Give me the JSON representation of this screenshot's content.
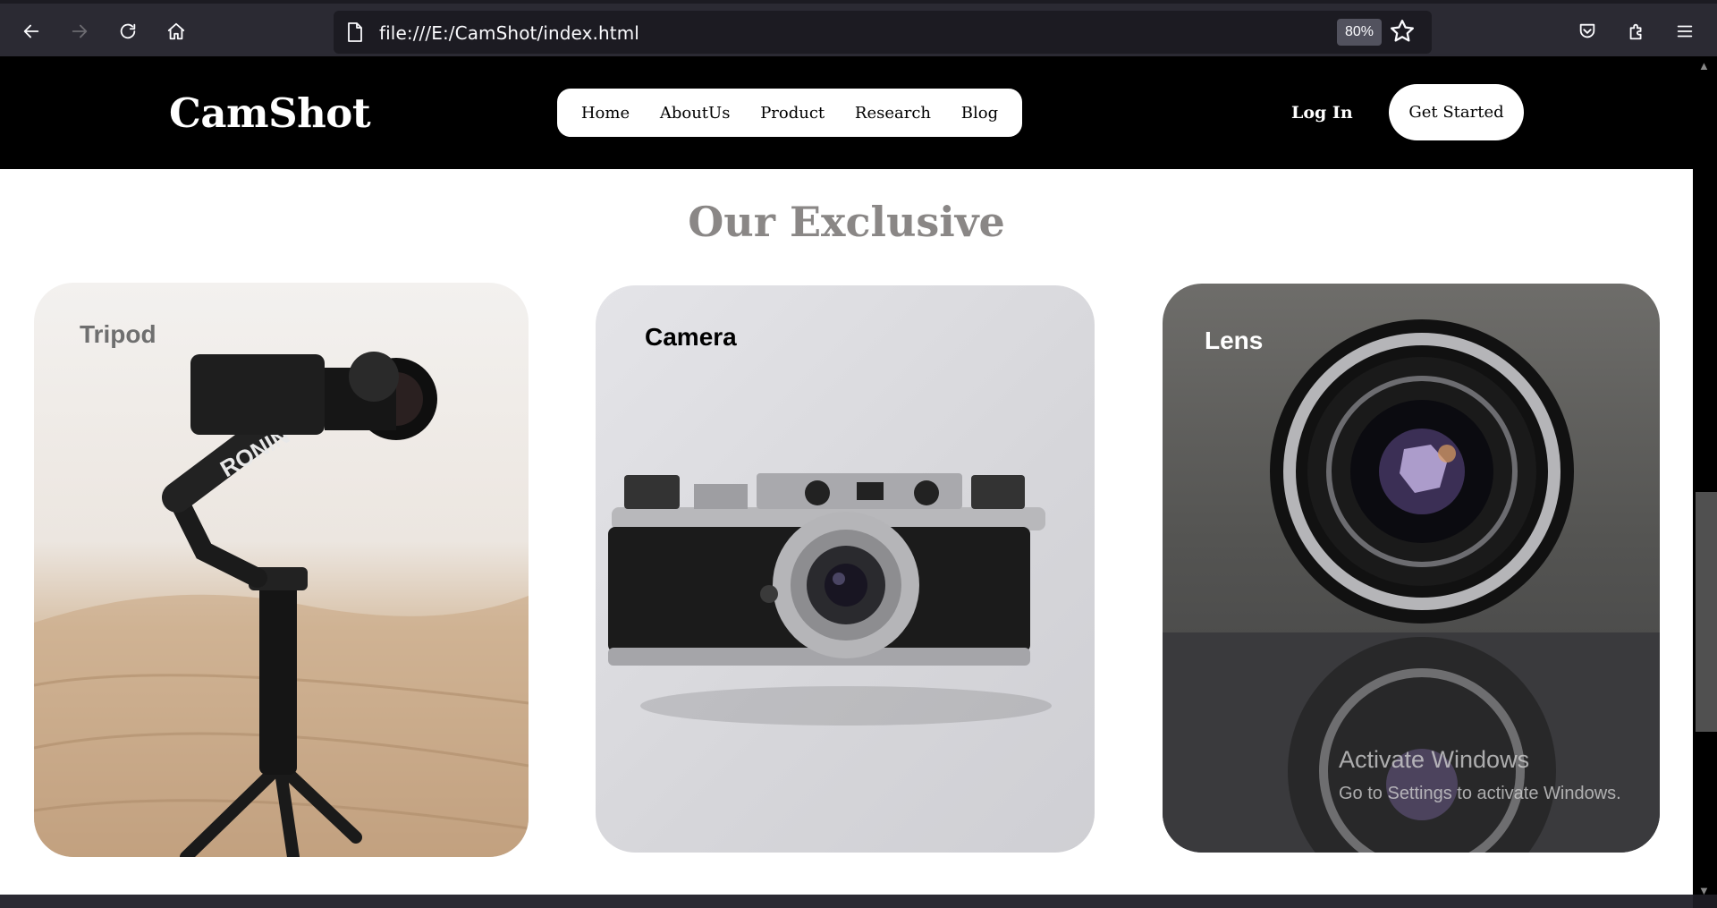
{
  "browser": {
    "url": "file:///E:/CamShot/index.html",
    "zoom": "80%",
    "icons": [
      "back-icon",
      "forward-icon",
      "reload-icon",
      "home-icon",
      "page-icon",
      "bookmark-star-icon",
      "pocket-icon",
      "extensions-icon",
      "menu-icon"
    ]
  },
  "site": {
    "logo": "CamShot",
    "nav": [
      "Home",
      "AboutUs",
      "Product",
      "Research",
      "Blog"
    ],
    "login": "Log In",
    "cta": "Get Started"
  },
  "section": {
    "title": "Our Exclusive",
    "cards": [
      {
        "label": "Tripod",
        "label_color": "#6f6f6f"
      },
      {
        "label": "Camera",
        "label_color": "#000000"
      },
      {
        "label": "Lens",
        "label_color": "#ffffff"
      }
    ]
  },
  "watermark": {
    "title": "Activate Windows",
    "subtitle": "Go to Settings to activate Windows."
  },
  "colors": {
    "header_bg": "#000000",
    "browser_bg": "#2b2a33",
    "title_gray": "#8a8786"
  }
}
